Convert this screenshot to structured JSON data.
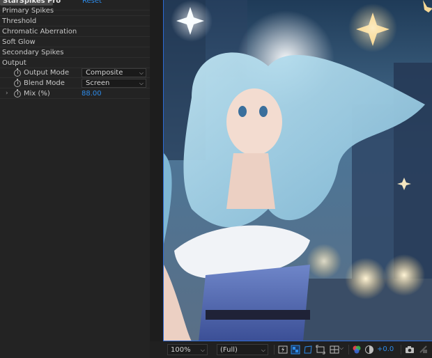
{
  "effect_controls": {
    "effect_name": "StarSpikes Pro",
    "reset_label": "Reset",
    "groups": [
      "Primary Spikes",
      "Threshold",
      "Chromatic Aberration",
      "Soft Glow",
      "Secondary Spikes",
      "Output"
    ],
    "output": {
      "output_mode_label": "Output Mode",
      "output_mode_value": "Composite",
      "blend_mode_label": "Blend Mode",
      "blend_mode_value": "Screen",
      "mix_label": "Mix (%)",
      "mix_value": "88.00"
    }
  },
  "viewer": {
    "zoom": "100%",
    "resolution": "(Full)",
    "exposure": "+0.0"
  },
  "colors": {
    "accent_blue": "#2d8ceb",
    "panel_bg": "#232323"
  }
}
